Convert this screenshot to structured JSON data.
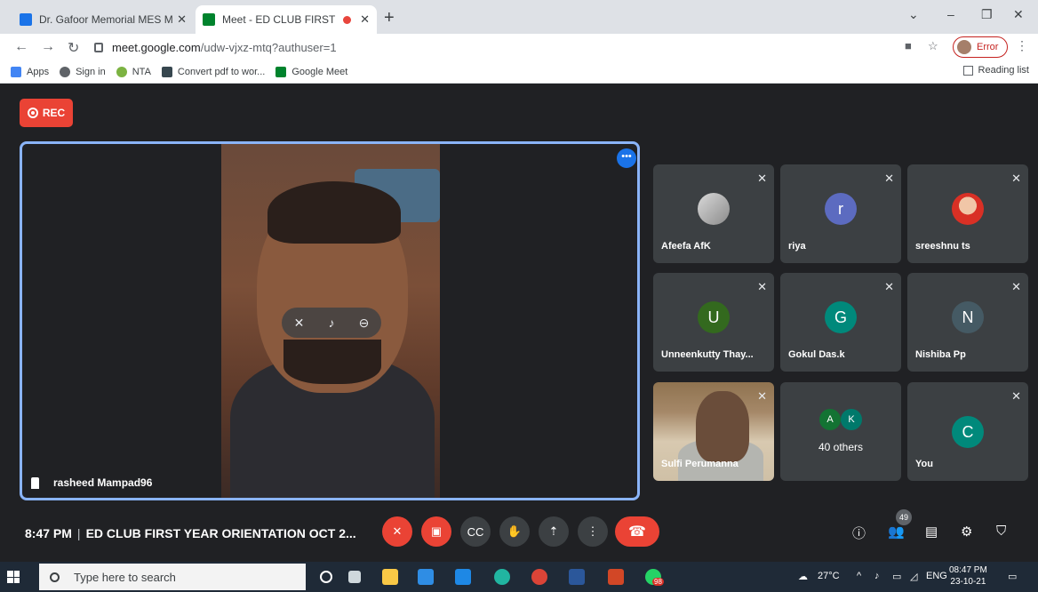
{
  "browser": {
    "tabs": [
      {
        "title": "Dr. Gafoor Memorial MES Mampad",
        "active": false
      },
      {
        "title": "Meet - ED CLUB FIRST YEAR",
        "active": true
      }
    ],
    "url_host": "meet.google.com",
    "url_path": "/udw-vjxz-mtq?authuser=1",
    "profile_label": "Error",
    "bookmarks": [
      "Apps",
      "Sign in",
      "NTA",
      "Convert pdf to wor...",
      "Google Meet"
    ],
    "reading_list": "Reading list"
  },
  "meet": {
    "rec_label": "REC",
    "pinned": {
      "name": "rasheed Mampad96"
    },
    "participants": [
      {
        "name": "Afeefa AfK",
        "type": "photo",
        "muted": true
      },
      {
        "name": "riya",
        "initial": "r",
        "color": "#5c6bc0",
        "muted": true
      },
      {
        "name": "sreeshnu ts",
        "type": "photo-red",
        "muted": true
      },
      {
        "name": "Unneenkutty Thay...",
        "initial": "U",
        "color": "#33691e",
        "muted": true
      },
      {
        "name": "Gokul Das.k",
        "initial": "G",
        "color": "#00897b",
        "muted": true
      },
      {
        "name": "Nishiba Pp",
        "initial": "N",
        "color": "#455a64",
        "muted": true
      },
      {
        "name": "Sulfi Perumanna",
        "type": "video",
        "muted": true
      },
      {
        "others_label": "40 others",
        "initials": [
          "A",
          "K"
        ]
      },
      {
        "name": "You",
        "initial": "C",
        "color": "#00897b",
        "muted": true
      }
    ],
    "time": "8:47 PM",
    "meeting_title": "ED CLUB FIRST YEAR ORIENTATION OCT 2...",
    "participant_count": "49"
  },
  "taskbar": {
    "search_placeholder": "Type here to search",
    "weather": "27°C",
    "lang": "ENG",
    "time": "08:47 PM",
    "date": "23-10-21",
    "chrome_badge": "98"
  }
}
